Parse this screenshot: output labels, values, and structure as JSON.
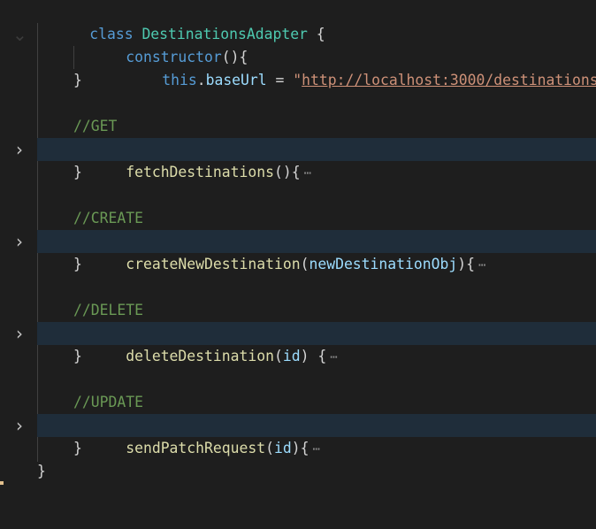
{
  "editor": {
    "class_keyword": "class",
    "class_name": "DestinationsAdapter",
    "class_open": " {",
    "class_close": "}",
    "constructor": {
      "name": "constructor",
      "sig": "(){",
      "body_this": "this",
      "body_dot": ".",
      "body_prop": "baseUrl",
      "body_eq": " = ",
      "quote_open": "\"",
      "url": "http://localhost:3000/destinations",
      "quote_close": "\"",
      "close": "}"
    },
    "methods": [
      {
        "comment": "//GET",
        "name": "fetchDestinations",
        "params_open": "()",
        "param": "",
        "params_close": "",
        "brace": "{",
        "ellipsis": "⋯",
        "close": "}"
      },
      {
        "comment": "//CREATE",
        "name": "createNewDestination",
        "params_open": "(",
        "param": "newDestinationObj",
        "params_close": ")",
        "brace": "{",
        "ellipsis": "⋯",
        "close": "}"
      },
      {
        "comment": "//DELETE",
        "name": "deleteDestination",
        "params_open": "(",
        "param": "id",
        "params_close": ") ",
        "brace": "{",
        "ellipsis": "⋯",
        "close": "}"
      },
      {
        "comment": "//UPDATE",
        "name": "sendPatchRequest",
        "params_open": "(",
        "param": "id",
        "params_close": ")",
        "brace": "{",
        "ellipsis": "⋯",
        "close": "}"
      }
    ],
    "icons": {
      "fold_expanded": "chevron-down-icon",
      "fold_collapsed": "chevron-right-icon"
    }
  }
}
